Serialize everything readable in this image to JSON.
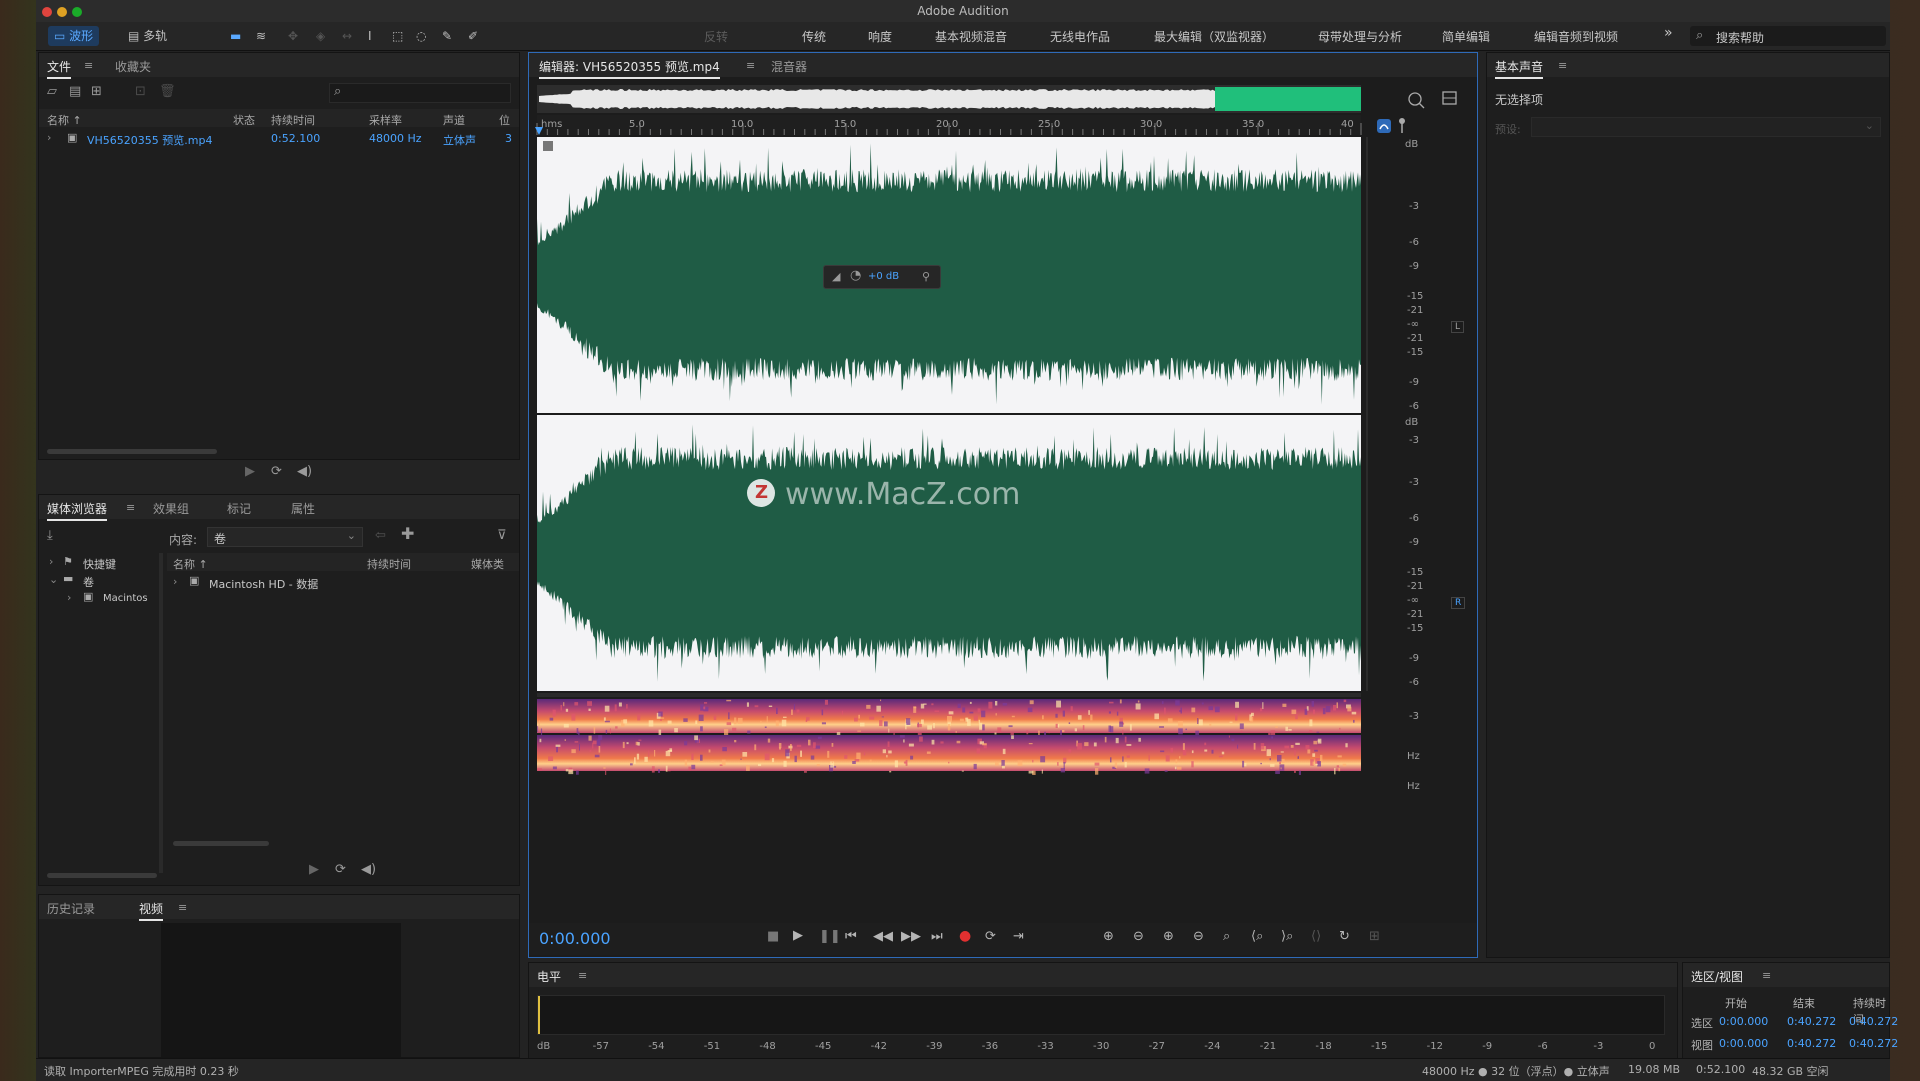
{
  "window": {
    "title": "Adobe Audition"
  },
  "toolbar": {
    "waveform_label": "波形",
    "multitrack_label": "多轨",
    "workspaces": [
      "反转",
      "传统",
      "响度",
      "基本视频混音",
      "无线电作品",
      "最大编辑（双监视器）",
      "母带处理与分析",
      "简单编辑",
      "编辑音频到视频"
    ],
    "more": "»",
    "search_placeholder": "搜索帮助"
  },
  "files_panel": {
    "tabs": [
      "文件",
      "收藏夹"
    ],
    "columns": [
      "名称 ↑",
      "状态",
      "持续时间",
      "采样率",
      "声道",
      "位"
    ],
    "rows": [
      {
        "name": "VH56520355 预览.mp4",
        "status": "",
        "duration": "0:52.100",
        "sample_rate": "48000 Hz",
        "channels": "立体声",
        "bits": "3"
      }
    ]
  },
  "media_browser": {
    "tabs": [
      "媒体浏览器",
      "效果组",
      "标记",
      "属性"
    ],
    "content_label": "内容:",
    "content_value": "卷",
    "tree": [
      "快捷键",
      "卷",
      "Macintos"
    ],
    "columns": [
      "名称 ↑",
      "持续时间",
      "媒体类"
    ],
    "rows": [
      {
        "name": "Macintosh HD - 数据"
      }
    ]
  },
  "history_panel": {
    "tabs": [
      "历史记录",
      "视频"
    ]
  },
  "editor": {
    "tabs": [
      "编辑器: VH56520355 预览.mp4",
      "混音器"
    ],
    "ruler_unit": "hms",
    "ruler_ticks": [
      "5.0",
      "10.0",
      "15.0",
      "20.0",
      "25.0",
      "30.0",
      "35.0",
      "40"
    ],
    "db_label": "dB",
    "db_scale_top": [
      "-3",
      "-6",
      "-9",
      "-15",
      "-21",
      "-∞",
      "-21",
      "-15",
      "-9",
      "-6",
      "-3"
    ],
    "db_scale_bottom": [
      "-3",
      "-6",
      "-9",
      "-15",
      "-21",
      "-∞",
      "-21",
      "-15",
      "-9",
      "-6",
      "-3"
    ],
    "channel_left": "L",
    "channel_right": "R",
    "hud_gain": "+0 dB",
    "watermark_letter": "Z",
    "watermark": "www.MacZ.com",
    "hz_label": "Hz",
    "timecode": "0:00.000"
  },
  "essential_sound": {
    "title": "基本声音",
    "no_selection": "无选择项",
    "preset_label": "预设:"
  },
  "levels": {
    "title": "电平",
    "scale": [
      "dB",
      "-57",
      "-54",
      "-51",
      "-48",
      "-45",
      "-42",
      "-39",
      "-36",
      "-33",
      "-30",
      "-27",
      "-24",
      "-21",
      "-18",
      "-15",
      "-12",
      "-9",
      "-6",
      "-3",
      "0"
    ]
  },
  "selection_view": {
    "title": "选区/视图",
    "headers": [
      "开始",
      "结束",
      "持续时间"
    ],
    "rows": [
      {
        "label": "选区",
        "start": "0:00.000",
        "end": "0:40.272",
        "duration": "0:40.272"
      },
      {
        "label": "视图",
        "start": "0:00.000",
        "end": "0:40.272",
        "duration": "0:40.272"
      }
    ]
  },
  "status_bar": {
    "message": "读取 ImporterMPEG 完成用时 0.23 秒",
    "items": [
      "48000 Hz ● 32 位（浮点）● 立体声",
      "19.08 MB",
      "0:52.100",
      "48.32 GB 空闲"
    ]
  },
  "colors": {
    "accent": "#4aa3ff",
    "waveform": "#1f5c45",
    "waveform_bg": "#f4f4f6",
    "record": "#e03030"
  }
}
